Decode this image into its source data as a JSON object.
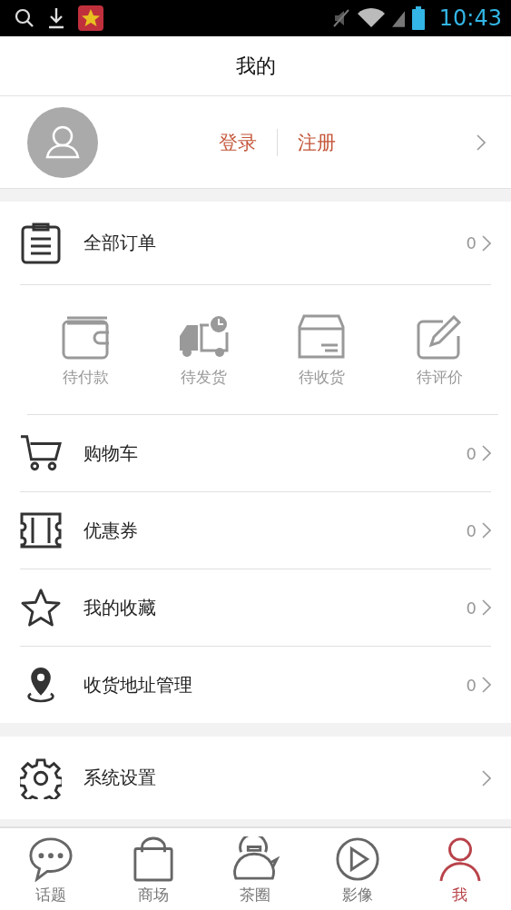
{
  "status_bar": {
    "time": "10:43"
  },
  "header": {
    "title": "我的"
  },
  "profile": {
    "login": "登录",
    "register": "注册"
  },
  "orders": {
    "label": "全部订单",
    "count": "0",
    "statuses": [
      {
        "kind": "wallet",
        "label": "待付款"
      },
      {
        "kind": "truck",
        "label": "待发货"
      },
      {
        "kind": "box",
        "label": "待收货"
      },
      {
        "kind": "edit",
        "label": "待评价"
      }
    ]
  },
  "menu": [
    {
      "kind": "cart",
      "label": "购物车",
      "count": "0"
    },
    {
      "kind": "coupon",
      "label": "优惠券",
      "count": "0"
    },
    {
      "kind": "star",
      "label": "我的收藏",
      "count": "0"
    },
    {
      "kind": "pin",
      "label": "收货地址管理",
      "count": "0"
    }
  ],
  "settings": {
    "label": "系统设置"
  },
  "tab_bar": [
    {
      "kind": "chat",
      "label": "话题",
      "selected": false
    },
    {
      "kind": "bag",
      "label": "商场",
      "selected": false
    },
    {
      "kind": "kettle",
      "label": "茶圈",
      "selected": false
    },
    {
      "kind": "play",
      "label": "影像",
      "selected": false
    },
    {
      "kind": "person",
      "label": "我",
      "selected": true
    }
  ]
}
